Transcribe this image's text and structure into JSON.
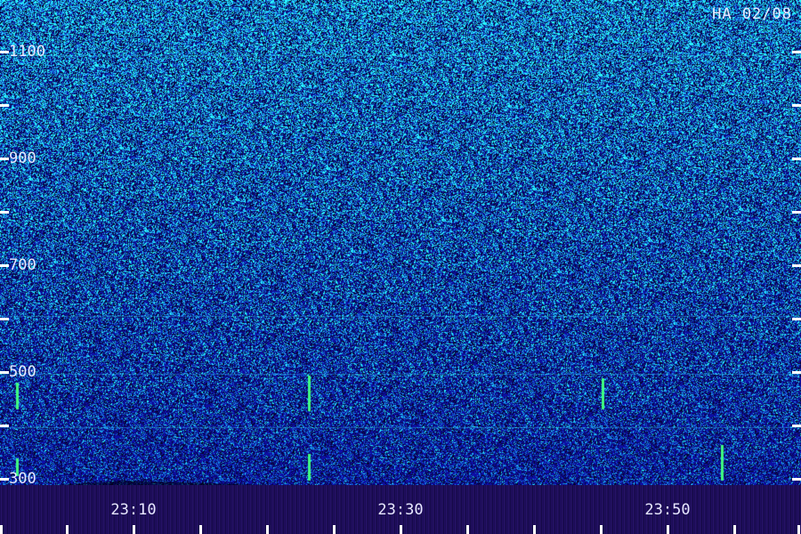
{
  "station_label": "HA 02/08",
  "frequency_axis": {
    "labels": [
      "1100",
      "900",
      "700",
      "500",
      "300"
    ],
    "range": [
      300,
      1200
    ]
  },
  "time_axis": {
    "labels": [
      "23:10",
      "23:30",
      "23:50"
    ]
  },
  "colors": {
    "background": "#0a0a6a",
    "noise_low": "#1a2ad8",
    "noise_high": "#30e0ff",
    "signal": "#40ff80"
  }
}
